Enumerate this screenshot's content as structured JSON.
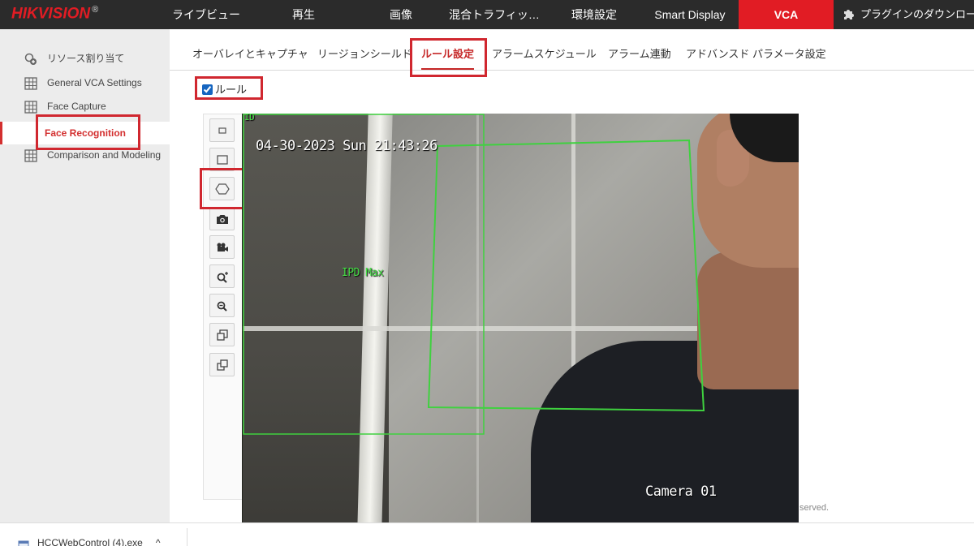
{
  "header": {
    "logo_text": "HIKVISION",
    "logo_mark": "®",
    "nav": [
      {
        "label": "ライブビュー"
      },
      {
        "label": "再生"
      },
      {
        "label": "画像"
      },
      {
        "label": "混合トラフィッ…"
      },
      {
        "label": "環境設定"
      },
      {
        "label": "Smart Display"
      },
      {
        "label": "VCA",
        "active": true
      }
    ],
    "plugin_label": "プラグインのダウンロード"
  },
  "sidebar": {
    "items": [
      {
        "label": "リソース割り当て",
        "icon": "resource-icon"
      },
      {
        "label": "General VCA Settings",
        "icon": "grid-icon"
      },
      {
        "label": "Face Capture",
        "icon": "grid-icon"
      },
      {
        "label": "Face Recognition",
        "selected": true
      },
      {
        "label": "Comparison and Modeling",
        "icon": "grid-icon"
      }
    ]
  },
  "tabs": [
    {
      "label": "オーバレイとキャプチャ"
    },
    {
      "label": "リージョンシールド"
    },
    {
      "label": "ルール設定",
      "active": true
    },
    {
      "label": "アラームスケジュール"
    },
    {
      "label": "アラーム連動"
    },
    {
      "label": "アドバンスド パラメータ設定"
    }
  ],
  "rule_checkbox": {
    "label": "ルール",
    "checked": true
  },
  "toolbar": [
    {
      "name": "small-rectangle-icon"
    },
    {
      "name": "rectangle-icon"
    },
    {
      "name": "polygon-icon"
    },
    {
      "name": "camera-icon"
    },
    {
      "name": "video-camera-icon"
    },
    {
      "name": "zoom-in-icon"
    },
    {
      "name": "zoom-out-icon"
    },
    {
      "name": "window-restore-icon"
    },
    {
      "name": "window-shrink-icon"
    }
  ],
  "video": {
    "timestamp": "04-30-2023 Sun 21:43:26",
    "camera_name": "Camera 01",
    "ipd_label": "IPD Max",
    "corner_label": "ID"
  },
  "footer_note": "served.",
  "download_bar": {
    "file": "HCCWebControl (4).exe",
    "chevron": "^"
  },
  "colors": {
    "accent": "#e11c24",
    "highlight": "#d0272f",
    "overlay_green": "#3fd13f"
  }
}
